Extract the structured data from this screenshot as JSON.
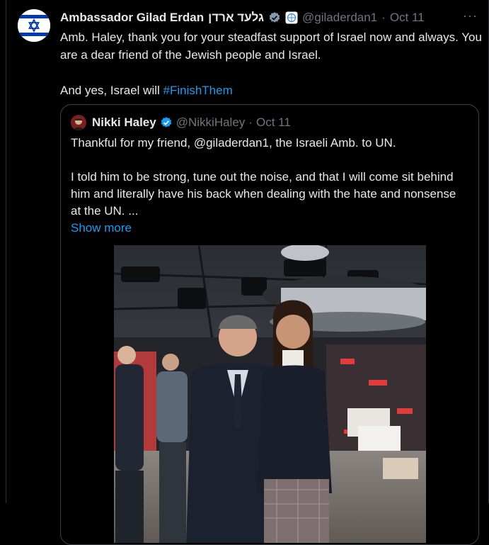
{
  "tweet": {
    "author_name": "Ambassador Gilad Erdan",
    "author_name_hebrew": "גלעד ארדן",
    "handle": "@giladerdan1",
    "separator": "·",
    "date": "Oct 11",
    "more_label": "···",
    "text_line1": "Amb. Haley, thank you for your steadfast support of Israel now and always. You are a dear friend of the Jewish people and Israel.",
    "text_prefix": "And yes, Israel will ",
    "hashtag": "#FinishThem",
    "avatar_icon": "israel-flag-icon",
    "verified_icon": "gray-verified-badge-icon",
    "affiliate_icon": "un-emblem-icon"
  },
  "quoted": {
    "author_name": "Nikki Haley",
    "handle": "@NikkiHaley",
    "separator": "·",
    "date": "Oct 11",
    "text_line1": "Thankful for my friend, @giladerdan1, the Israeli Amb. to UN.",
    "text_line2": "I told him to be strong, tune out the noise, and that I will come sit behind him and literally have his back when dealing with the hate and nonsense at the UN. ...",
    "show_more": "Show more",
    "verified_icon": "blue-verified-badge-icon",
    "photo_icon": "tv-studio-photo"
  },
  "colors": {
    "background": "#000000",
    "text": "#e7e9ea",
    "muted": "#71767b",
    "link": "#1d9bf0",
    "border": "#3e4144"
  }
}
